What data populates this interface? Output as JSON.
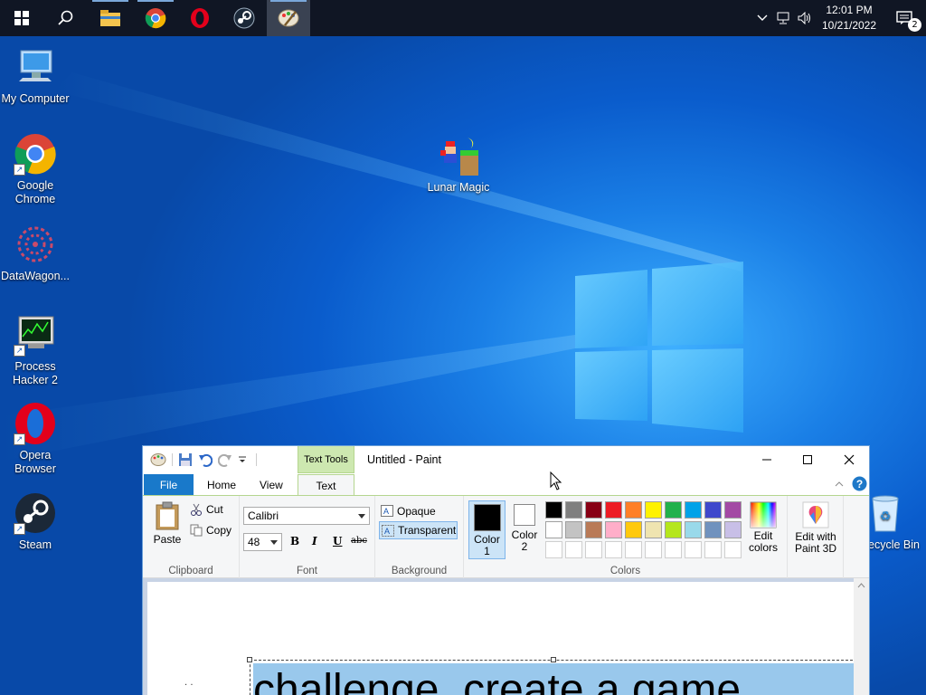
{
  "taskbar": {
    "start": "start-icon",
    "apps": [
      {
        "name": "search-icon"
      },
      {
        "name": "file-explorer-icon"
      },
      {
        "name": "chrome-icon"
      },
      {
        "name": "opera-icon"
      },
      {
        "name": "steam-icon"
      },
      {
        "name": "paint-icon"
      }
    ],
    "clock": {
      "time": "12:01 PM",
      "date": "10/21/2022"
    },
    "notification_count": "2"
  },
  "desktop": {
    "icons": [
      {
        "label": "My Computer"
      },
      {
        "label": "Google Chrome"
      },
      {
        "label": "DataWagon..."
      },
      {
        "label": "Process Hacker 2"
      },
      {
        "label": "Opera Browser"
      },
      {
        "label": "Steam"
      },
      {
        "label": "Lunar Magic"
      },
      {
        "label": "Recycle Bin"
      }
    ]
  },
  "paint": {
    "title": "Untitled - Paint",
    "context_tab": "Text Tools",
    "tabs": {
      "file": "File",
      "home": "Home",
      "view": "View",
      "text": "Text"
    },
    "clipboard": {
      "paste": "Paste",
      "cut": "Cut",
      "copy": "Copy",
      "label": "Clipboard"
    },
    "font": {
      "family": "Calibri",
      "size": "48",
      "bold": "B",
      "italic": "I",
      "underline": "U",
      "strike": "abc",
      "label": "Font"
    },
    "background": {
      "opaque": "Opaque",
      "transparent": "Transparent",
      "label": "Background"
    },
    "colors": {
      "color1": "Color 1",
      "color2": "Color 2",
      "edit": "Edit colors",
      "label": "Colors",
      "color1_value": "#000000",
      "color2_value": "#ffffff",
      "palette_row1": [
        "#000000",
        "#7f7f7f",
        "#880015",
        "#ed1c24",
        "#ff7f27",
        "#fff200",
        "#22b14c",
        "#00a2e8",
        "#3f48cc",
        "#a349a4"
      ],
      "palette_row2": [
        "#ffffff",
        "#c3c3c3",
        "#b97a57",
        "#ffaec9",
        "#ffc90e",
        "#efe4b0",
        "#b5e61d",
        "#99d9ea",
        "#7092be",
        "#c8bfe7"
      ]
    },
    "paint3d": {
      "label": "Edit with Paint 3D"
    },
    "canvas_text": "challenge, create a game"
  }
}
